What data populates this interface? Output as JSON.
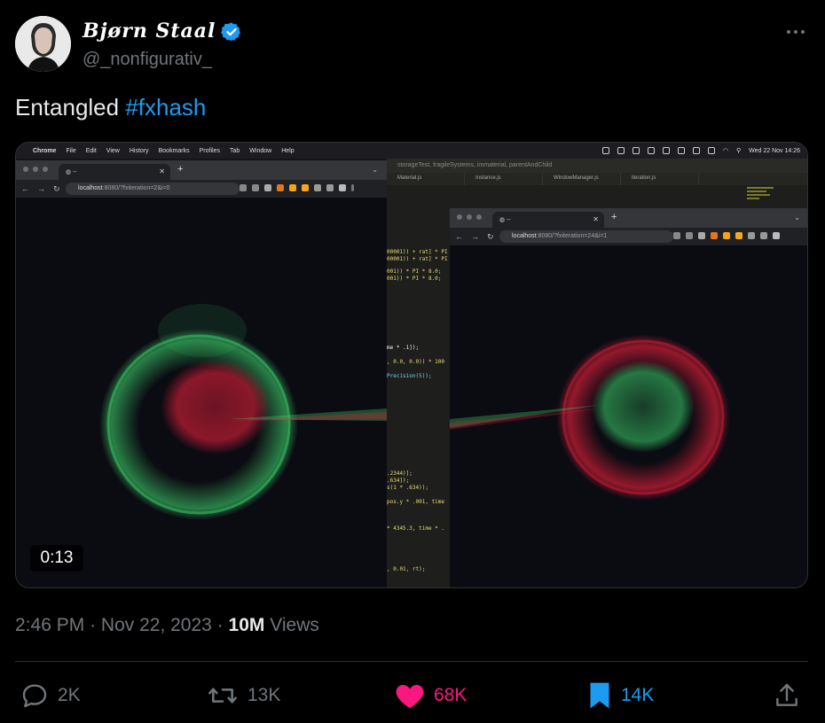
{
  "author": {
    "name": "Bjørn Staal",
    "handle": "@_nonfigurativ_",
    "verified_icon": "verified-badge-icon"
  },
  "tweet": {
    "text": "Entangled ",
    "hashtag": "#fxhash"
  },
  "media": {
    "duration": "0:13",
    "menubar": {
      "app": "Chrome",
      "items": [
        "File",
        "Edit",
        "View",
        "History",
        "Bookmarks",
        "Profiles",
        "Tab",
        "Window",
        "Help"
      ],
      "clock": "Wed 22 Nov  14:26"
    },
    "editor": {
      "title": "storageTest, fragileSystems, immaterial, parentAndChild",
      "tabs": [
        "Material.js",
        "Instance.js",
        "WindowManager.js",
        "iteration.js"
      ],
      "code_lines": [
        "00001)) + rat] * PI",
        "00001)) + rat] * PI",
        "001)) * PI * 8.0;",
        "001)) * PI * 8.0;",
        "me * .1]);",
        ", 0.0, 0.0)) * 100",
        "Precision(5));",
        ".2344)];",
        ".634]);",
        "s(1 * .634));",
        "pos.y * .001, time",
        "* 4345.3, time * .",
        ", 0.01, rt);"
      ]
    },
    "browser_left": {
      "tab_title": "--",
      "url_host": "localhost",
      "url_path": ":8080/?fxiteration=2&i=0"
    },
    "browser_right": {
      "tab_title": "--",
      "url_host": "localhost",
      "url_path": ":8080/?fxiteration=24&i=1"
    }
  },
  "meta": {
    "time": "2:46 PM",
    "separator": "·",
    "date": "Nov 22, 2023",
    "views_count": "10M",
    "views_label": " Views"
  },
  "actions": {
    "replies": "2K",
    "reposts": "13K",
    "likes": "68K",
    "bookmarks": "14K"
  },
  "colors": {
    "accent": "#1d9bf0",
    "like": "#f91880",
    "muted": "#71767b",
    "green_particles": "#3ccf6a",
    "red_particles": "#e0203a"
  }
}
